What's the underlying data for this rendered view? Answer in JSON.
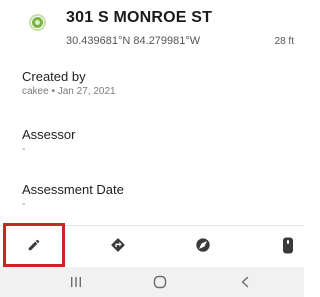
{
  "header": {
    "title": "301 S MONROE ST",
    "coordinates": "30.439681°N  84.279981°W",
    "distance": "28 ft",
    "status_color": "#7cb342"
  },
  "fields": [
    {
      "label": "Created by",
      "value": "cakee • Jan 27, 2021"
    },
    {
      "label": "Assessor",
      "value": "-"
    },
    {
      "label": "Assessment Date",
      "value": "-"
    }
  ],
  "toolbar": {
    "items": [
      {
        "icon": "pencil-icon",
        "selected": true
      },
      {
        "icon": "directions-icon"
      },
      {
        "icon": "compass-icon"
      },
      {
        "icon": "phone-device-icon"
      }
    ],
    "highlight_color": "#c62828"
  },
  "system_nav": {
    "items": [
      {
        "icon": "recent-apps-icon",
        "glyph": "|||"
      },
      {
        "icon": "home-icon"
      },
      {
        "icon": "back-icon",
        "glyph": "<"
      }
    ]
  }
}
